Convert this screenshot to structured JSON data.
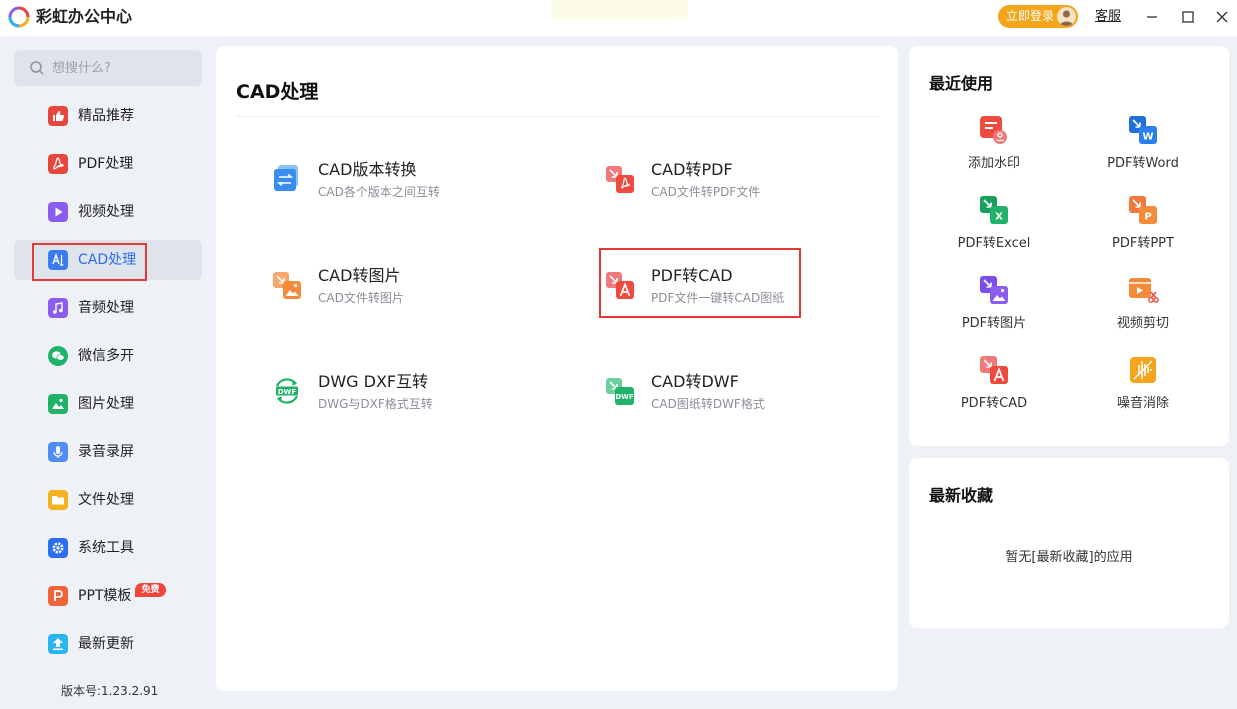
{
  "app": {
    "title": "彩虹办公中心",
    "login_label": "立即登录",
    "service_label": "客服"
  },
  "search": {
    "placeholder": "想搜什么?"
  },
  "sidebar": {
    "items": [
      {
        "label": "精品推荐",
        "icon": "thumbs-up-icon",
        "color": "#e8463c"
      },
      {
        "label": "PDF处理",
        "icon": "pdf-icon",
        "color": "#e8463c"
      },
      {
        "label": "视频处理",
        "icon": "play-icon",
        "color": "#8a5cf0"
      },
      {
        "label": "CAD处理",
        "icon": "cad-icon",
        "color": "#3a7bf0",
        "active": true
      },
      {
        "label": "音频处理",
        "icon": "music-icon",
        "color": "#8a5cf0"
      },
      {
        "label": "微信多开",
        "icon": "wechat-icon",
        "color": "#1fb36a"
      },
      {
        "label": "图片处理",
        "icon": "image-icon",
        "color": "#1fb36a"
      },
      {
        "label": "录音录屏",
        "icon": "microphone-icon",
        "color": "#4f8df5"
      },
      {
        "label": "文件处理",
        "icon": "folder-icon",
        "color": "#f4b21c"
      },
      {
        "label": "系统工具",
        "icon": "gear-icon",
        "color": "#2a6ff0"
      },
      {
        "label": "PPT模板",
        "icon": "ppt-icon",
        "color": "#f0643c",
        "badge": "免费"
      },
      {
        "label": "最新更新",
        "icon": "upload-icon",
        "color": "#2ab5f0"
      }
    ],
    "version": "版本号:1.23.2.91"
  },
  "main": {
    "title": "CAD处理",
    "tools": [
      {
        "name": "CAD版本转换",
        "desc": "CAD各个版本之间互转",
        "icon": "cad-version-convert-icon"
      },
      {
        "name": "CAD转PDF",
        "desc": "CAD文件转PDF文件",
        "icon": "cad-to-pdf-icon"
      },
      {
        "name": "CAD转图片",
        "desc": "CAD文件转图片",
        "icon": "cad-to-image-icon"
      },
      {
        "name": "PDF转CAD",
        "desc": "PDF文件一键转CAD图纸",
        "icon": "pdf-to-cad-icon",
        "highlighted": true
      },
      {
        "name": "DWG DXF互转",
        "desc": "DWG与DXF格式互转",
        "icon": "dwg-dxf-icon"
      },
      {
        "name": "CAD转DWF",
        "desc": "CAD图纸转DWF格式",
        "icon": "cad-to-dwf-icon"
      }
    ]
  },
  "recent": {
    "title": "最近使用",
    "items": [
      {
        "label": "添加水印",
        "icon": "watermark-icon"
      },
      {
        "label": "PDF转Word",
        "icon": "pdf-to-word-icon"
      },
      {
        "label": "PDF转Excel",
        "icon": "pdf-to-excel-icon"
      },
      {
        "label": "PDF转PPT",
        "icon": "pdf-to-ppt-icon"
      },
      {
        "label": "PDF转图片",
        "icon": "pdf-to-image-icon"
      },
      {
        "label": "视频剪切",
        "icon": "video-cut-icon"
      },
      {
        "label": "PDF转CAD",
        "icon": "pdf-to-cad-icon"
      },
      {
        "label": "噪音消除",
        "icon": "noise-removal-icon"
      }
    ]
  },
  "favorites": {
    "title": "最新收藏",
    "empty_text": "暂无[最新收藏]的应用"
  }
}
